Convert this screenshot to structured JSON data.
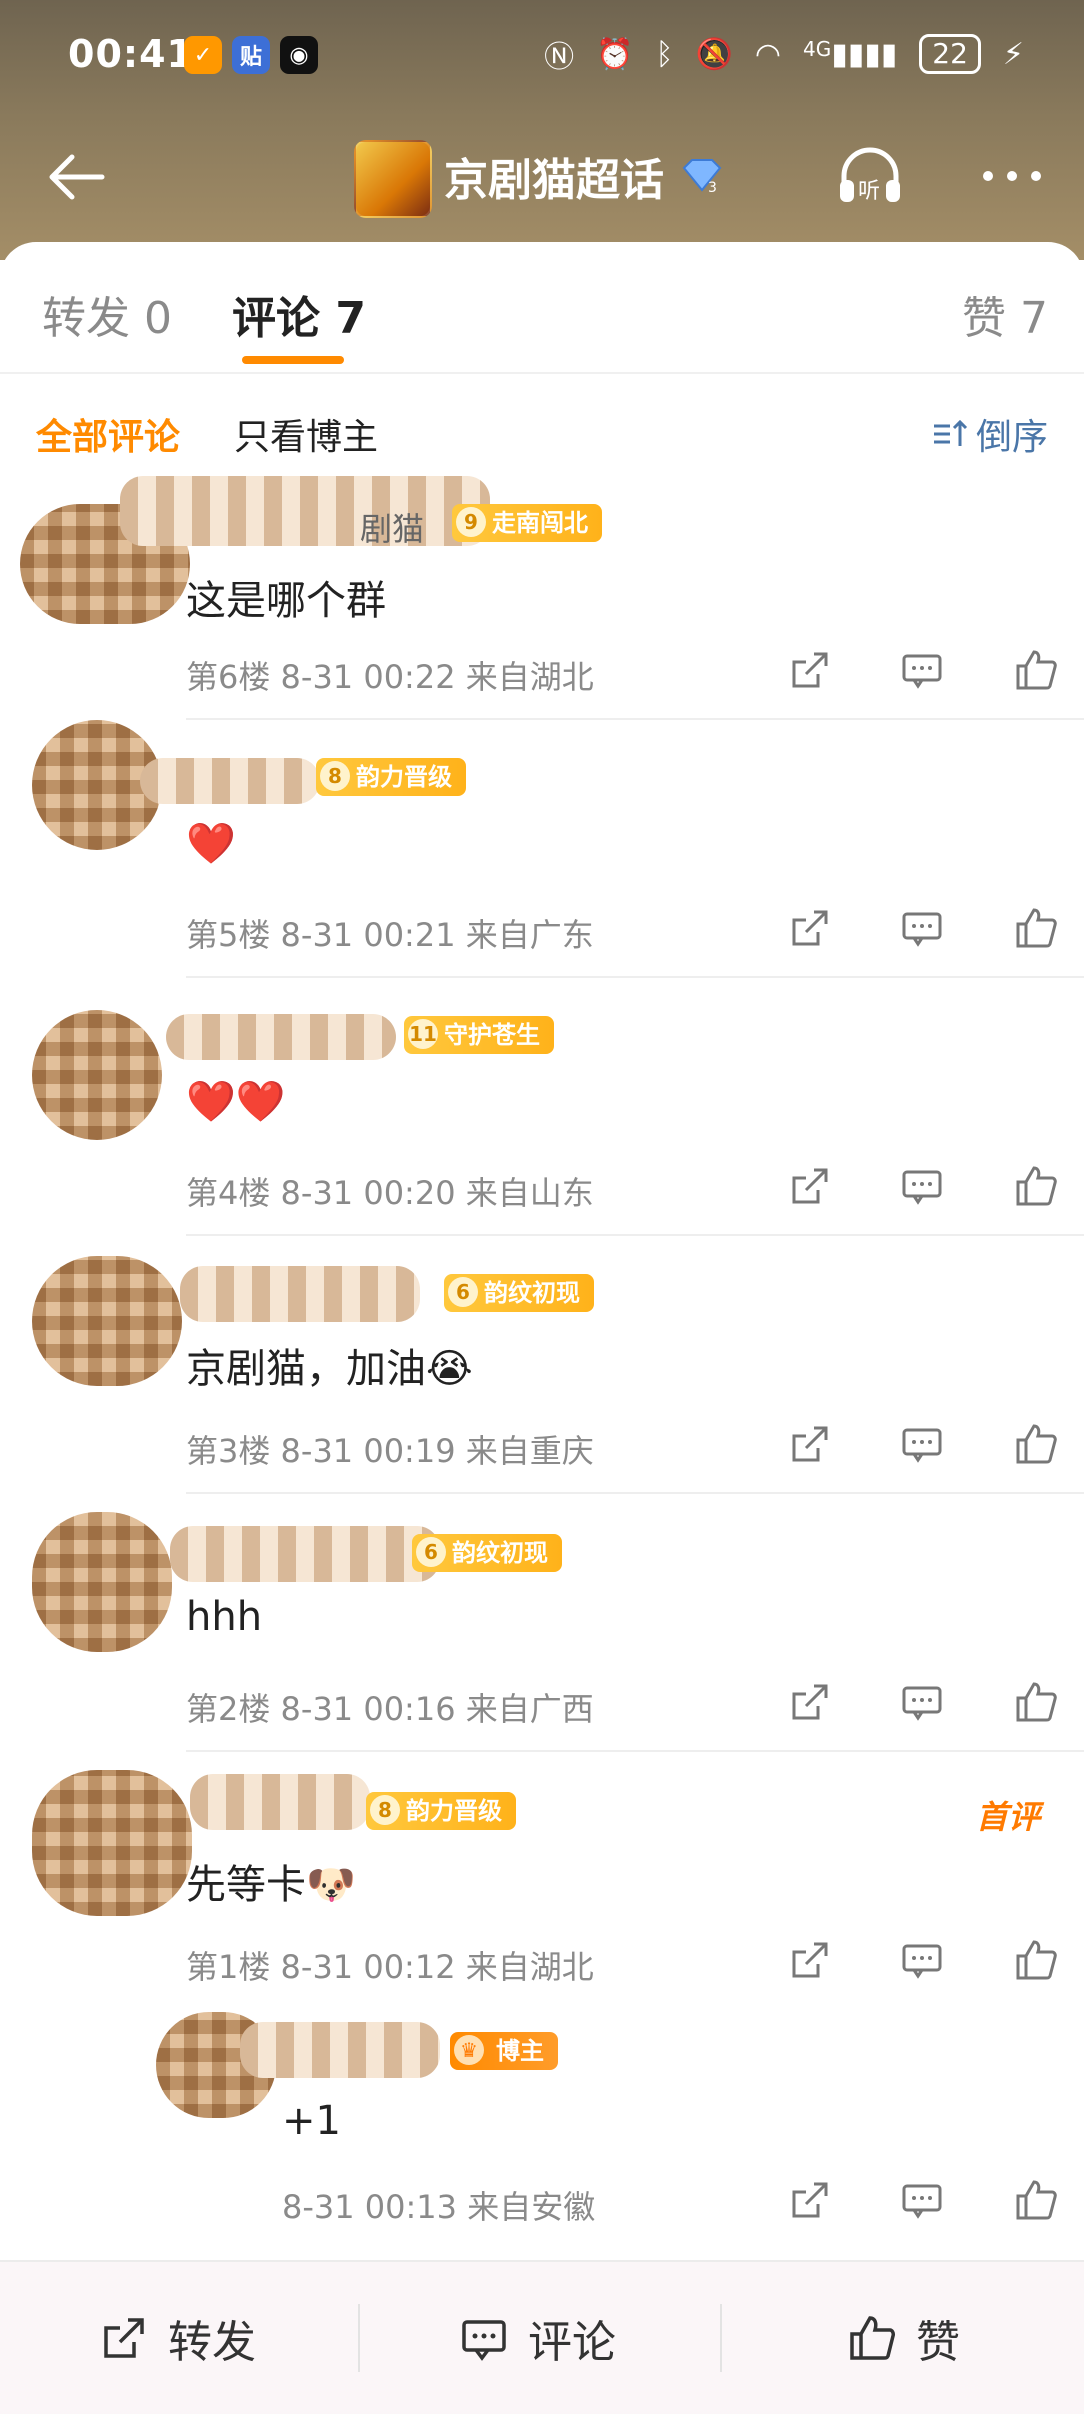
{
  "status": {
    "time": "00:41",
    "app_icons": [
      "tieba-app-icon",
      "tieba-badge-icon",
      "qq-icon"
    ],
    "net": "4G",
    "battery": "22"
  },
  "nav": {
    "title": "京剧猫超话"
  },
  "tabs": {
    "repost": "转发 0",
    "comment": "评论 7",
    "like": "赞 7"
  },
  "filter": {
    "all": "全部评论",
    "host_only": "只看博主",
    "order": "倒序"
  },
  "comments": [
    {
      "name_partial": "剧猫",
      "level": "9",
      "badge": "走南闯北",
      "text": "这是哪个群",
      "meta": "第6楼 8-31 00:22 来自湖北"
    },
    {
      "level": "8",
      "badge": "韵力晋级",
      "text": "❤️",
      "meta": "第5楼 8-31 00:21 来自广东"
    },
    {
      "level": "11",
      "badge": "守护苍生",
      "text": "❤️❤️",
      "meta": "第4楼 8-31 00:20 来自山东"
    },
    {
      "level": "6",
      "badge": "韵纹初现",
      "text": "京剧猫，加油😭",
      "meta": "第3楼 8-31 00:19 来自重庆"
    },
    {
      "level": "6",
      "badge": "韵纹初现",
      "text": "hhh",
      "meta": "第2楼 8-31 00:16 来自广西"
    },
    {
      "level": "8",
      "badge": "韵力晋级",
      "text": "先等卡🐶",
      "meta": "第1楼 8-31 00:12 来自湖北",
      "tag": "首评"
    },
    {
      "badge": "博主",
      "text": "+1",
      "meta": "8-31 00:13 来自安徽"
    }
  ],
  "bottom": {
    "repost": "转发",
    "comment": "评论",
    "like": "赞"
  }
}
